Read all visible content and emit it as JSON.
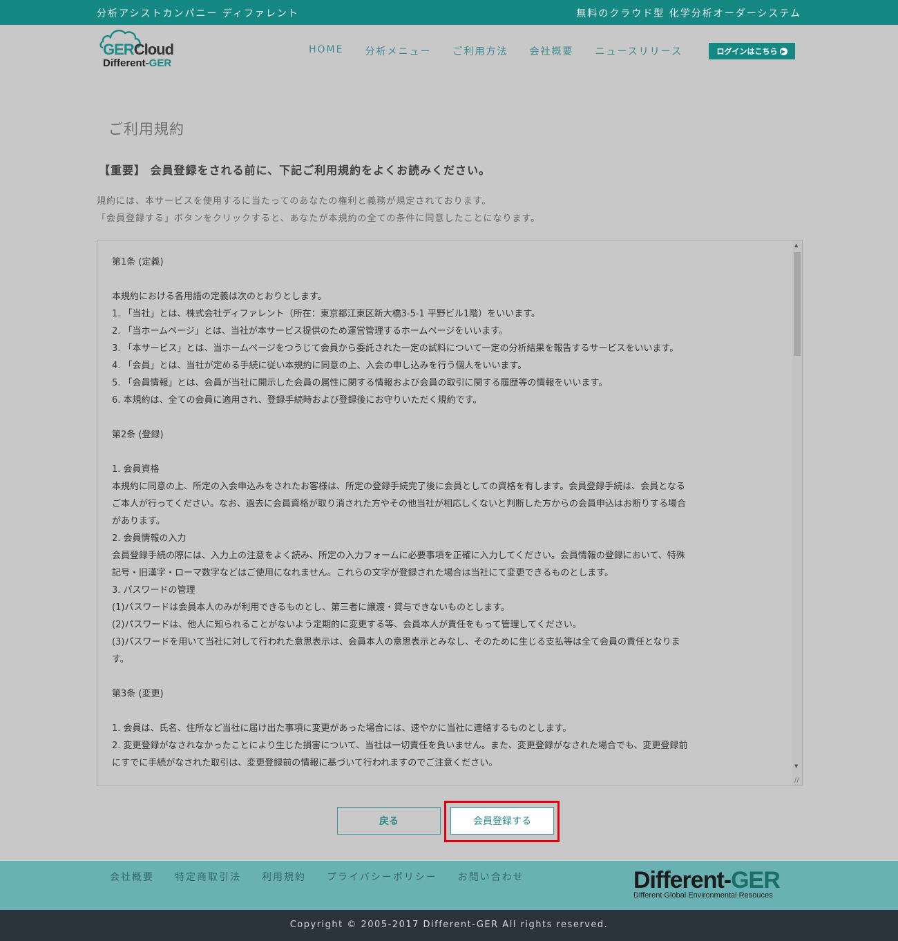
{
  "topbar": {
    "left": "分析アシストカンパニー ディファレント",
    "right": "無料のクラウド型 化学分析オーダーシステム"
  },
  "logo": {
    "line1_a": "GER",
    "line1_b": "Cloud",
    "line2_a": "Different-",
    "line2_b": "GER"
  },
  "nav": {
    "items": [
      "HOME",
      "分析メニュー",
      "ご利用方法",
      "会社概要",
      "ニュースリリース"
    ],
    "login": "ログインはこちら"
  },
  "page_title": "ご利用規約",
  "notice": "【重要】 会員登録をされる前に、下記ご利用規約をよくお読みください。",
  "intro": [
    "規約には、本サービスを使用するに当たってのあなたの権利と義務が規定されております。",
    "「会員登録する」ボタンをクリックすると、あなたが本規約の全ての条件に同意したことになります。"
  ],
  "terms": [
    "第1条 (定義)",
    "",
    "本規約における各用語の定義は次のとおりとします。",
    "1. 「当社」とは、株式会社ディファレント（所在：東京都江東区新大橋3-5-1 平野ビル1階）をいいます。",
    "2. 「当ホームページ」とは、当社が本サービス提供のため運営管理するホームページをいいます。",
    "3. 「本サービス」とは、当ホームページをつうじて会員から委託された一定の試料について一定の分析結果を報告するサービスをいいます。",
    "4. 「会員」とは、当社が定める手続に従い本規約に同意の上、入会の申し込みを行う個人をいいます。",
    "5. 「会員情報」とは、会員が当社に開示した会員の属性に関する情報および会員の取引に関する履歴等の情報をいいます。",
    "6. 本規約は、全ての会員に適用され、登録手続時および登録後にお守りいただく規約です。",
    "",
    "第2条 (登録)",
    "",
    "1. 会員資格",
    "本規約に同意の上、所定の入会申込みをされたお客様は、所定の登録手続完了後に会員としての資格を有します。会員登録手続は、会員となる",
    "ご本人が行ってください。なお、過去に会員資格が取り消された方やその他当社が相応しくないと判断した方からの会員申込はお断りする場合",
    "があります。",
    "2. 会員情報の入力",
    "会員登録手続の際には、入力上の注意をよく読み、所定の入力フォームに必要事項を正確に入力してください。会員情報の登録において、特殊",
    "記号・旧漢字・ローマ数字などはご使用になれません。これらの文字が登録された場合は当社にて変更できるものとします。",
    "3. パスワードの管理",
    "(1)パスワードは会員本人のみが利用できるものとし、第三者に譲渡・貸与できないものとします。",
    "(2)パスワードは、他人に知られることがないよう定期的に変更する等、会員本人が責任をもって管理してください。",
    "(3)パスワードを用いて当社に対して行われた意思表示は、会員本人の意思表示とみなし、そのために生じる支払等は全て会員の責任となりま",
    "す。",
    "",
    "第3条 (変更)",
    "",
    "1. 会員は、氏名、住所など当社に届け出た事項に変更があった場合には、速やかに当社に連絡するものとします。",
    "2. 変更登録がなされなかったことにより生じた損害について、当社は一切責任を負いません。また、変更登録がなされた場合でも、変更登録前",
    "にすでに手続がなされた取引は、変更登録前の情報に基づいて行われますのでご注意ください。"
  ],
  "buttons": {
    "back": "戻る",
    "register": "会員登録する"
  },
  "footer": {
    "links": [
      "会社概要",
      "特定商取引法",
      "利用規約",
      "プライバシーポリシー",
      "お問い合わせ"
    ],
    "logo_a": "Different-",
    "logo_b": "GER",
    "logo_sub": "Different Global Environmental Resouces",
    "copyright": "Copyright © 2005-2017 Different-GER All rights reserved."
  },
  "colors": {
    "topbar": "#168884",
    "footer": "#6ab1b4",
    "copyright_bg": "#2b333d",
    "highlight": "#e00010"
  }
}
